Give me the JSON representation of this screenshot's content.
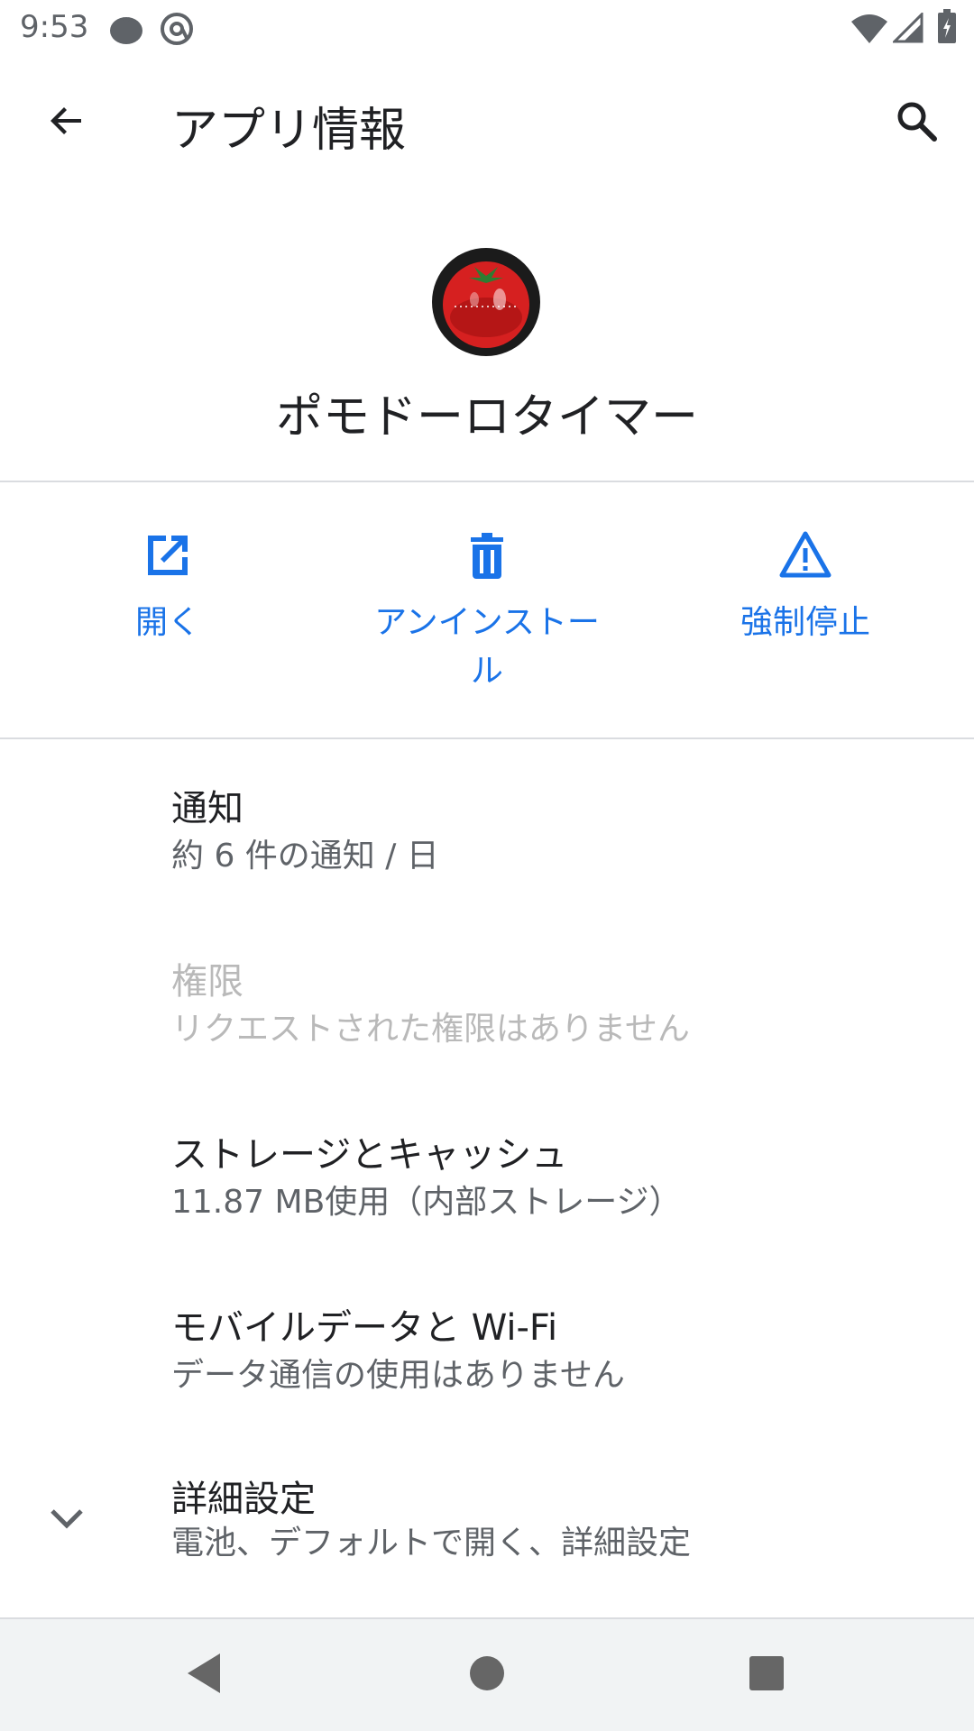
{
  "status_bar": {
    "time": "9:53",
    "icons_left": [
      "tomato-notification-icon",
      "at-sign-notification-icon"
    ],
    "icons_right": [
      "wifi-icon",
      "cell-signal-icon",
      "battery-charging-icon"
    ]
  },
  "app_bar": {
    "title": "アプリ情報",
    "back_icon": "arrow-left-icon",
    "search_icon": "search-icon"
  },
  "app_header": {
    "name": "ポモドーロタイマー",
    "icon": "tomato-timer-icon"
  },
  "actions": [
    {
      "label": "開く",
      "icon": "open-external-icon"
    },
    {
      "label": "アンインストール",
      "icon": "trash-icon"
    },
    {
      "label": "強制停止",
      "icon": "warning-icon"
    }
  ],
  "settings": [
    {
      "title": "通知",
      "summary": "約 6 件の通知 / 日",
      "enabled": true
    },
    {
      "title": "権限",
      "summary": "リクエストされた権限はありません",
      "enabled": false
    },
    {
      "title": "ストレージとキャッシュ",
      "summary": "11.87 MB使用（内部ストレージ）",
      "enabled": true
    },
    {
      "title": "モバイルデータと Wi-Fi",
      "summary": "データ通信の使用はありません",
      "enabled": true
    },
    {
      "title": "詳細設定",
      "summary": "電池、デフォルトで開く、詳細設定",
      "enabled": true,
      "icon": "chevron-down-icon"
    }
  ],
  "nav_bar": {
    "buttons": [
      "back-triangle-icon",
      "home-circle-icon",
      "recents-square-icon"
    ]
  },
  "colors": {
    "accent": "#1a73e8",
    "text_primary": "#202124",
    "text_secondary": "#5f6368",
    "text_disabled": "#b9b9b9",
    "divider": "#dadce0",
    "nav_bar_bg": "#f1f3f4"
  }
}
